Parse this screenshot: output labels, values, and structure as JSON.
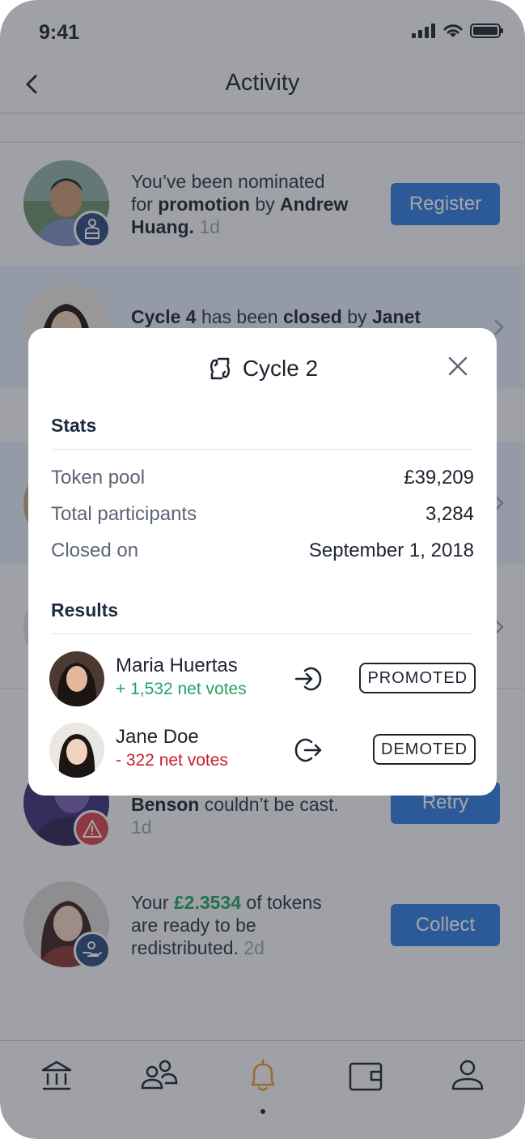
{
  "status_bar": {
    "time": "9:41"
  },
  "header": {
    "title": "Activity"
  },
  "feed": [
    {
      "text_a": "You’ve been nominated",
      "text_b": "for ",
      "bold_b": "promotion",
      "text_b2": " by ",
      "bold_b2": "Andrew",
      "bold_c": "Huang.",
      "age": "1d",
      "button": "Register"
    },
    {
      "bold_a": "Cycle 4",
      "text_a": " has been ",
      "bold_a2": "closed",
      "text_a2": " by ",
      "bold_a3": "Janet"
    },
    {
      "bold_a": "Benson",
      "text_a": " couldn’t be cast.",
      "age": "1d",
      "button": "Retry"
    },
    {
      "text_a": "Your ",
      "amount": "£2.3534",
      "text_a2": " of tokens",
      "text_b": "are ready to be",
      "text_c": "redistributed.",
      "age": "2d",
      "button": "Collect"
    }
  ],
  "modal": {
    "title": "Cycle 2",
    "stats_title": "Stats",
    "stats": [
      {
        "label": "Token pool",
        "value": "£39,209"
      },
      {
        "label": "Total participants",
        "value": "3,284"
      },
      {
        "label": "Closed on",
        "value": "September 1, 2018"
      }
    ],
    "results_title": "Results",
    "results": [
      {
        "name": "Maria Huertas",
        "votes": "+ 1,532 net votes",
        "tag": "PROMOTED"
      },
      {
        "name": "Jane Doe",
        "votes": "- 322 net votes",
        "tag": "DEMOTED"
      }
    ]
  },
  "colors": {
    "accent": "#2f7de1",
    "positive": "#1fa463",
    "negative": "#c8202f",
    "active_tab": "#e89a2e",
    "badge_navy": "#2b4a7e",
    "badge_red": "#d9424a"
  },
  "icons": {
    "tabs": [
      "bank-icon",
      "people-icon",
      "bell-icon",
      "wallet-icon",
      "profile-icon"
    ]
  }
}
